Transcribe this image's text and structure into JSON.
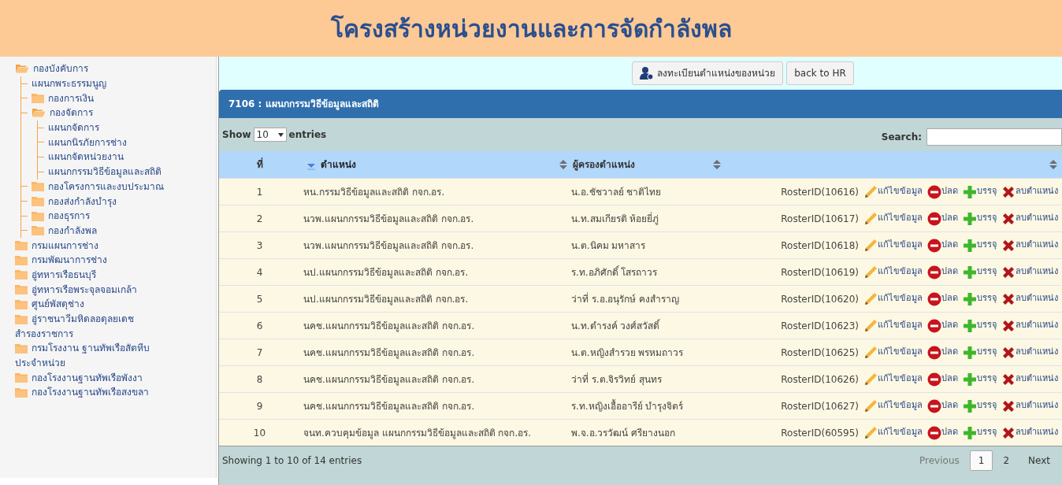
{
  "header": {
    "title": "โครงสร้างหน่วยงานและการจัดกำลังพล"
  },
  "tree": [
    {
      "label": "กองบังคับการ",
      "kind": "folder",
      "expanded": true,
      "children": [
        {
          "label": "แผนกพระธรรมนูญ",
          "kind": "leaf"
        },
        {
          "label": "กองการเงิน",
          "kind": "folder",
          "expanded": false
        },
        {
          "label": "กองจัดการ",
          "kind": "folder",
          "expanded": true,
          "children": [
            {
              "label": "แผนกจัดการ",
              "kind": "leaf"
            },
            {
              "label": "แผนกนิรภัยการช่าง",
              "kind": "leaf"
            },
            {
              "label": "แผนกจัดหน่วยงาน",
              "kind": "leaf"
            },
            {
              "label": "แผนกกรรมวิธีข้อมูลและสถิติ",
              "kind": "leaf"
            }
          ]
        },
        {
          "label": "กองโครงการและงบประมาณ",
          "kind": "folder",
          "expanded": false
        },
        {
          "label": "กองส่งกำลังบำรุง",
          "kind": "folder",
          "expanded": false
        },
        {
          "label": "กองธุรการ",
          "kind": "folder",
          "expanded": false
        },
        {
          "label": "กองกำลังพล",
          "kind": "folder",
          "expanded": false
        }
      ]
    },
    {
      "label": "กรมแผนการช่าง",
      "kind": "folder",
      "expanded": false
    },
    {
      "label": "กรมพัฒนาการช่าง",
      "kind": "folder",
      "expanded": false
    },
    {
      "label": "อู่ทหารเรือธนบุรี",
      "kind": "folder",
      "expanded": false
    },
    {
      "label": "อู่ทหารเรือพระจุลจอมเกล้า",
      "kind": "folder",
      "expanded": false
    },
    {
      "label": "ศูนย์พัสดุช่าง",
      "kind": "folder",
      "expanded": false
    },
    {
      "label": "อู่ราชนาวีมหิดลอดุลยเดช",
      "kind": "folder",
      "expanded": false
    },
    {
      "label": "สำรองราชการ",
      "kind": "leaf"
    },
    {
      "label": "กรมโรงงาน ฐานทัพเรือสัตหีบ",
      "kind": "folder",
      "expanded": false
    },
    {
      "label": "ประจำหน่วย",
      "kind": "leaf"
    },
    {
      "label": "กองโรงงานฐานทัพเรือพังงา",
      "kind": "folder",
      "expanded": false
    },
    {
      "label": "กองโรงงานฐานทัพเรือสงขลา",
      "kind": "folder",
      "expanded": false
    }
  ],
  "toolbar": {
    "buttons": [
      {
        "label": "ลงทะเบียนตำแหน่งของหน่วย",
        "kind": "register"
      },
      {
        "label": "back to HR",
        "kind": "plain"
      }
    ]
  },
  "panel": {
    "title": "7106 : แผนกกรรมวิธีข้อมูลและสถิติ"
  },
  "length_control": {
    "before": "Show",
    "value": "10",
    "after": "entries"
  },
  "search": {
    "label": "Search:"
  },
  "columns": [
    {
      "label": "ที่",
      "sortable": false,
      "sorted": false
    },
    {
      "label": "ตำแหน่ง",
      "sortable": true,
      "sorted": true
    },
    {
      "label": "ผู้ครองตำแหน่ง",
      "sortable": true,
      "sorted": false
    },
    {
      "sortable": true,
      "sorted": false
    },
    {
      "sortable": true,
      "sorted": false
    }
  ],
  "rows": [
    {
      "no": "1",
      "position": "หน.กรรมวิธีข้อมูลและสถิติ กจก.อร.",
      "holder": "น.อ.ชัชวาลย์ ชาติไทย",
      "roster": "RosterID(10616)",
      "actions": [
        {
          "kind": "edit",
          "label": "แก้ไขข้อมูล"
        },
        {
          "kind": "discharge",
          "label": "ปลด"
        },
        {
          "kind": "appoint",
          "label": "บรรจุ"
        },
        {
          "kind": "delete",
          "label": "ลบตำแหน่ง"
        }
      ]
    },
    {
      "no": "2",
      "position": "นวพ.แผนกกรรมวิธีข้อมูลและสถิติ กจก.อร.",
      "holder": "น.ท.สมเกียรติ ห้อยยี่ภู่",
      "roster": "RosterID(10617)",
      "actions": [
        {
          "kind": "edit",
          "label": "แก้ไขข้อมูล"
        },
        {
          "kind": "discharge",
          "label": "ปลด"
        },
        {
          "kind": "appoint",
          "label": "บรรจุ"
        },
        {
          "kind": "delete",
          "label": "ลบตำแหน่ง"
        }
      ]
    },
    {
      "no": "3",
      "position": "นวพ.แผนกกรรมวิธีข้อมูลและสถิติ กจก.อร.",
      "holder": "น.ต.นิคม มหาสาร",
      "roster": "RosterID(10618)",
      "actions": [
        {
          "kind": "edit",
          "label": "แก้ไขข้อมูล"
        },
        {
          "kind": "discharge",
          "label": "ปลด"
        },
        {
          "kind": "appoint",
          "label": "บรรจุ"
        },
        {
          "kind": "delete",
          "label": "ลบตำแหน่ง"
        }
      ]
    },
    {
      "no": "4",
      "position": "นป.แผนกกรรมวิธีข้อมูลและสถิติ กจก.อร.",
      "holder": "ร.ท.อภิศักดิ์ โสรถาวร",
      "roster": "RosterID(10619)",
      "actions": [
        {
          "kind": "edit",
          "label": "แก้ไขข้อมูล"
        },
        {
          "kind": "discharge",
          "label": "ปลด"
        },
        {
          "kind": "appoint",
          "label": "บรรจุ"
        },
        {
          "kind": "delete",
          "label": "ลบตำแหน่ง"
        }
      ]
    },
    {
      "no": "5",
      "position": "นป.แผนกกรรมวิธีข้อมูลและสถิติ กจก.อร.",
      "holder": "ว่าที่ ร.อ.อนุรักษ์ คงสำราญ",
      "roster": "RosterID(10620)",
      "actions": [
        {
          "kind": "edit",
          "label": "แก้ไขข้อมูล"
        },
        {
          "kind": "discharge",
          "label": "ปลด"
        },
        {
          "kind": "appoint",
          "label": "บรรจุ"
        },
        {
          "kind": "delete",
          "label": "ลบตำแหน่ง"
        }
      ]
    },
    {
      "no": "6",
      "position": "นคช.แผนกกรรมวิธีข้อมูลและสถิติ กจก.อร.",
      "holder": "น.ท.ดำรงค์ วงศ์สวัสดิ์",
      "roster": "RosterID(10623)",
      "actions": [
        {
          "kind": "edit",
          "label": "แก้ไขข้อมูล"
        },
        {
          "kind": "discharge",
          "label": "ปลด"
        },
        {
          "kind": "appoint",
          "label": "บรรจุ"
        },
        {
          "kind": "delete",
          "label": "ลบตำแหน่ง"
        }
      ]
    },
    {
      "no": "7",
      "position": "นคช.แผนกกรรมวิธีข้อมูลและสถิติ กจก.อร.",
      "holder": "น.ต.หญิงสำรวย พรหมถาวร",
      "roster": "RosterID(10625)",
      "actions": [
        {
          "kind": "edit",
          "label": "แก้ไขข้อมูล"
        },
        {
          "kind": "discharge",
          "label": "ปลด"
        },
        {
          "kind": "appoint",
          "label": "บรรจุ"
        },
        {
          "kind": "delete",
          "label": "ลบตำแหน่ง"
        }
      ]
    },
    {
      "no": "8",
      "position": "นคช.แผนกกรรมวิธีข้อมูลและสถิติ กจก.อร.",
      "holder": "ว่าที่ ร.ต.จิรวิทย์ สุนทร",
      "roster": "RosterID(10626)",
      "actions": [
        {
          "kind": "edit",
          "label": "แก้ไขข้อมูล"
        },
        {
          "kind": "discharge",
          "label": "ปลด"
        },
        {
          "kind": "appoint",
          "label": "บรรจุ"
        },
        {
          "kind": "delete",
          "label": "ลบตำแหน่ง"
        }
      ]
    },
    {
      "no": "9",
      "position": "นคช.แผนกกรรมวิธีข้อมูลและสถิติ กจก.อร.",
      "holder": "ร.ท.หญิงเอื้ออารีย์ บำรุงจิตร์",
      "roster": "RosterID(10627)",
      "actions": [
        {
          "kind": "edit",
          "label": "แก้ไขข้อมูล"
        },
        {
          "kind": "discharge",
          "label": "ปลด"
        },
        {
          "kind": "appoint",
          "label": "บรรจุ"
        },
        {
          "kind": "delete",
          "label": "ลบตำแหน่ง"
        }
      ]
    },
    {
      "no": "10",
      "position": "จนท.ควบคุมข้อมูล แผนกกรรมวิธีข้อมูลและสถิติ กจก.อร.",
      "holder": "พ.จ.อ.วรวัฒน์ ศรียางนอก",
      "roster": "RosterID(60595)",
      "actions": [
        {
          "kind": "edit",
          "label": "แก้ไขข้อมูล"
        },
        {
          "kind": "discharge",
          "label": "ปลด"
        },
        {
          "kind": "appoint",
          "label": "บรรจุ"
        },
        {
          "kind": "delete",
          "label": "ลบตำแหน่ง"
        }
      ]
    }
  ],
  "info": "Showing 1 to 10 of 14 entries",
  "pagination": [
    {
      "label": "Previous",
      "selected": false,
      "disabled": true
    },
    {
      "label": "1",
      "selected": true,
      "disabled": false
    },
    {
      "label": "2",
      "selected": false,
      "disabled": false
    },
    {
      "label": "Next",
      "selected": false,
      "disabled": false
    }
  ]
}
